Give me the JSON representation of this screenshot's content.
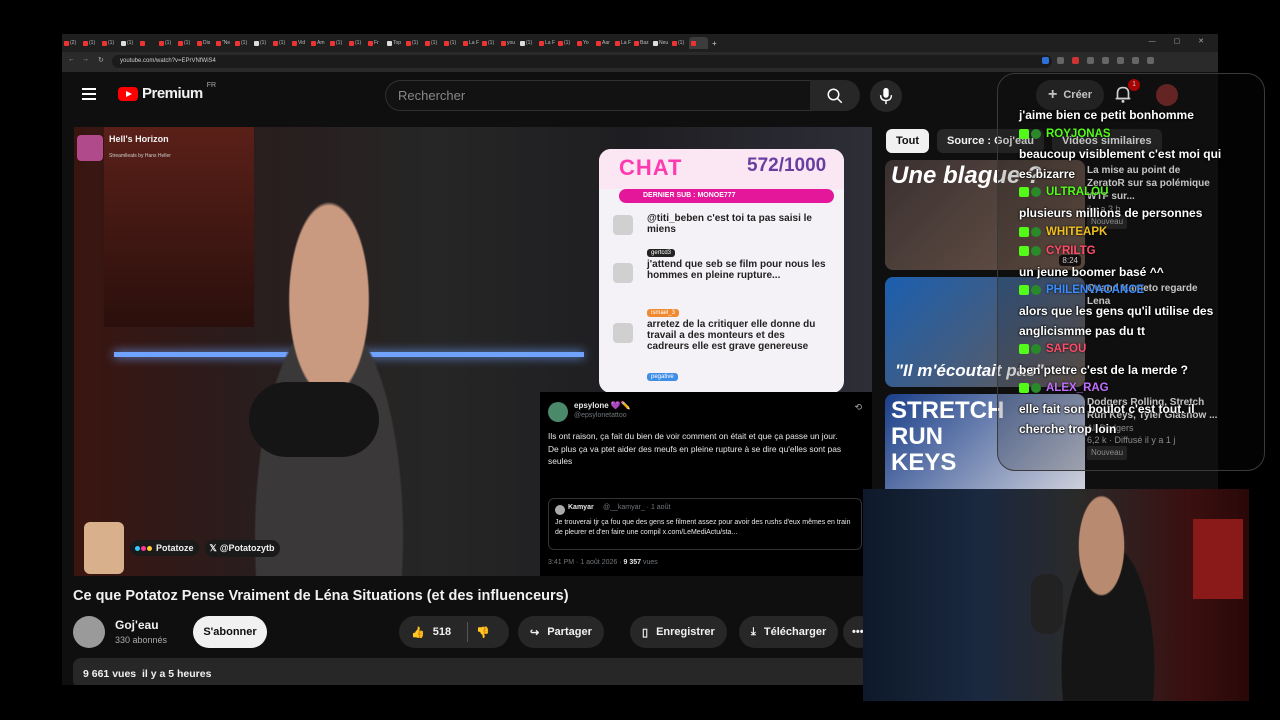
{
  "browser": {
    "tabs": [
      "(2)",
      "(1)",
      "(1)",
      "(1)",
      "",
      "(1)",
      "(1)",
      "Dis",
      "\"Ne",
      "(1)",
      "(1)",
      "(1)",
      "Vid",
      "Am",
      "(1)",
      "(1)",
      "Fr",
      "Top",
      "(1)",
      "(1)",
      "(1)",
      "La F",
      "(1)",
      "you",
      "(1)",
      "La F",
      "(1)",
      "Yo",
      "Aar",
      "La F",
      "Baz",
      "Neu",
      "(1)",
      ""
    ],
    "url": "youtube.com/watch?v=EPrVNfWiS4"
  },
  "youtube": {
    "logo_text": "Premium",
    "logo_sup": "FR",
    "search_placeholder": "Rechercher",
    "create_label": "Créer",
    "notif_count": "1"
  },
  "video_overlay": {
    "channel_name": "Hell's Horizon",
    "channel_sub": "Streamlleats by Hans Heller",
    "social_1": "Potatoze",
    "social_2": "@Potatozytb"
  },
  "chat_panel": {
    "title": "CHAT",
    "count": "572/1000",
    "last_sub": "DERNIER SUB : MONOE777",
    "messages": [
      {
        "user": "",
        "text": "@titi_beben c'est toi ta pas saisi le miens"
      },
      {
        "user": "gertcd3",
        "text": "j'attend que seb se film pour nous les hommes en pleine rupture..."
      },
      {
        "user": "ismael_3",
        "text": "arretez de la critiquer elle donne du travail a des monteurs et des cadreurs elle est grave genereuse",
        "tag": "pegative"
      }
    ]
  },
  "tweet": {
    "name": "epsylone 💜✏️",
    "handle": "@epsylonetattoo",
    "body_1": "Ils ont raison, ça fait du bien de voir comment on était et que ça passe un jour.",
    "body_2": "De plus ça va ptet aider des meufs en pleine rupture à se dire qu'elles sont pas seules",
    "quote_name": "Kamyar",
    "quote_handle": "@__kamyar_ · 1 août",
    "quote_text": "Je trouverai tjr ça fou que des gens se filment assez pour avoir des rushs d'eux mêmes en train de pleurer et d'en faire une compil x.com/LeMediActu/sta...",
    "footer_time": "3:41 PM · 1 août 2026 ·",
    "footer_views": "9 357",
    "footer_views_label": "vues"
  },
  "video": {
    "title": "Ce que Potatoz Pense Vraiment de Léna Situations (et des influenceurs)",
    "channel": "Goj'eau",
    "subscribers": "330 abonnés",
    "subscribe_label": "S'abonner",
    "likes": "518",
    "share_label": "Partager",
    "save_label": "Enregistrer",
    "download_label": "Télécharger",
    "views": "9 661 vues",
    "posted": "il y a 5 heures"
  },
  "chips": {
    "all": "Tout",
    "source": "Source : Goj'eau",
    "similar": "Vidéos similaires"
  },
  "related": [
    {
      "thumb_text": "Une blague ?",
      "title": "La mise au point de ZeratoR sur sa polémique WTF sur...",
      "meta": "il y a 3 h",
      "badge": "Nouveau",
      "duration": "8:24"
    },
    {
      "thumb_text": "\"Il m'écoutait pas\"",
      "title": "Quand Kameto regarde Lena",
      "meta": "",
      "badge": "",
      "duration": ""
    },
    {
      "thumb_text": "STRETCH RUN KEYS",
      "title": "Dodgers Rolling, Stretch Run Keys, Tyler Glasnow ...",
      "channel": "All Dodgers",
      "meta": "6,2 k · Diffusé il y a 1 j",
      "badge": "Nouveau"
    }
  ],
  "kick_chat": [
    {
      "text": "j'aime bien ce petit bonhomme"
    },
    {
      "name": "ROYJONAS",
      "color": "#53fc18"
    },
    {
      "text": "beaucoup visiblement c'est moi qui"
    },
    {
      "text": "es bizarre"
    },
    {
      "name": "ULTRALOU",
      "color": "#53fc18"
    },
    {
      "text": "plusieurs millions de personnes"
    },
    {
      "name": "WHITEAPK",
      "color": "#f0c020"
    },
    {
      "name": "CYRILTG",
      "color": "#ff4d6a"
    },
    {
      "text": "un jeune boomer basé ^^"
    },
    {
      "name": "PHILENVACANCE",
      "color": "#3a8cff"
    },
    {
      "text": "alors que les gens qu'il utilise des"
    },
    {
      "text": "anglicismme pas du tt"
    },
    {
      "name": "SAFOU",
      "color": "#ff4d6a"
    },
    {
      "text": "ben ptetre c'est de la merde ?"
    },
    {
      "name": "ALEX_RAG",
      "color": "#c070ff"
    },
    {
      "text": "elle fait son boulot c'est tout. il"
    },
    {
      "text": "cherche trop loin"
    }
  ]
}
